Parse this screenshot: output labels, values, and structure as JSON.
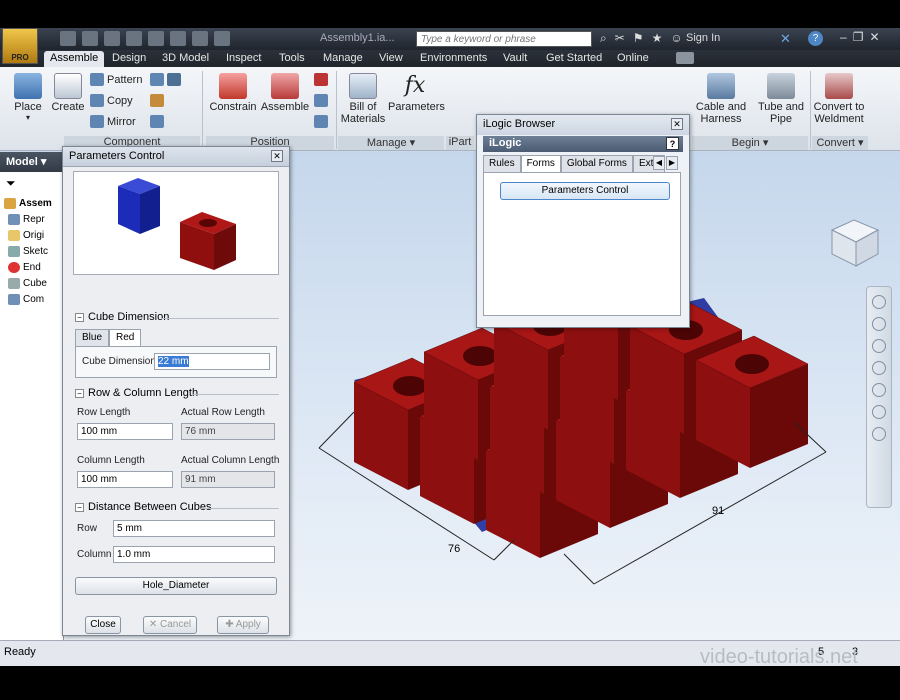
{
  "app": {
    "logo_text": "PRO",
    "doc_title": "Assembly1.ia...",
    "search_placeholder": "Type a keyword or phrase",
    "sign_in": "Sign In"
  },
  "tabs": [
    "Assemble",
    "Design",
    "3D Model",
    "Inspect",
    "Tools",
    "Manage",
    "View",
    "Environments",
    "Vault",
    "Get Started",
    "Online"
  ],
  "ribbon": {
    "place": "Place",
    "create": "Create",
    "pattern": "Pattern",
    "copy": "Copy",
    "mirror": "Mirror",
    "constrain": "Constrain",
    "assemble": "Assemble",
    "bom_line1": "Bill of",
    "bom_line2": "Materials",
    "parameters": "Parameters",
    "cable_line1": "Cable and",
    "cable_line2": "Harness",
    "tube_line1": "Tube and",
    "tube_line2": "Pipe",
    "weld_line1": "Convert to",
    "weld_line2": "Weldment",
    "group_component": "Component",
    "group_position": "Position",
    "group_manage": "Manage ▾",
    "group_ipart": "iPart",
    "group_begin": "Begin ▾",
    "group_convert": "Convert ▾"
  },
  "browser": {
    "title": "Model ▾",
    "items": [
      "Assem",
      "Repr",
      "Origi",
      "Sketc",
      "End",
      "Cube",
      "Com"
    ]
  },
  "params_dialog": {
    "title": "Parameters Control",
    "cube_dimension_title": "Cube Dimension",
    "subtab_blue": "Blue",
    "subtab_red": "Red",
    "cube_dimension_label": "Cube Dimension",
    "cube_dimension_value": "22 mm",
    "row_col_title": "Row & Column Length",
    "row_length_label": "Row Length",
    "row_length_value": "100 mm",
    "actual_row_label": "Actual Row Length",
    "actual_row_value": "76 mm",
    "col_length_label": "Column Length",
    "col_length_value": "100 mm",
    "actual_col_label": "Actual Column Length",
    "actual_col_value": "91 mm",
    "distance_title": "Distance Between Cubes",
    "row_label": "Row",
    "row_value": "5 mm",
    "column_label": "Column",
    "column_value": "1.0 mm",
    "hole_button": "Hole_Diameter",
    "close": "Close",
    "cancel": "Cancel",
    "apply": "Apply"
  },
  "ilogic": {
    "title": "iLogic Browser",
    "header": "iLogic",
    "help": "?",
    "tabs": [
      "Rules",
      "Forms",
      "Global Forms",
      "Exte"
    ],
    "form_button": "Parameters Control"
  },
  "viewport": {
    "dim_row": "76",
    "dim_col": "91",
    "cube_color": "#8b0d0d"
  },
  "status": {
    "text": "Ready",
    "num1": "5",
    "num2": "3"
  },
  "watermark": "video-tutorials.net"
}
